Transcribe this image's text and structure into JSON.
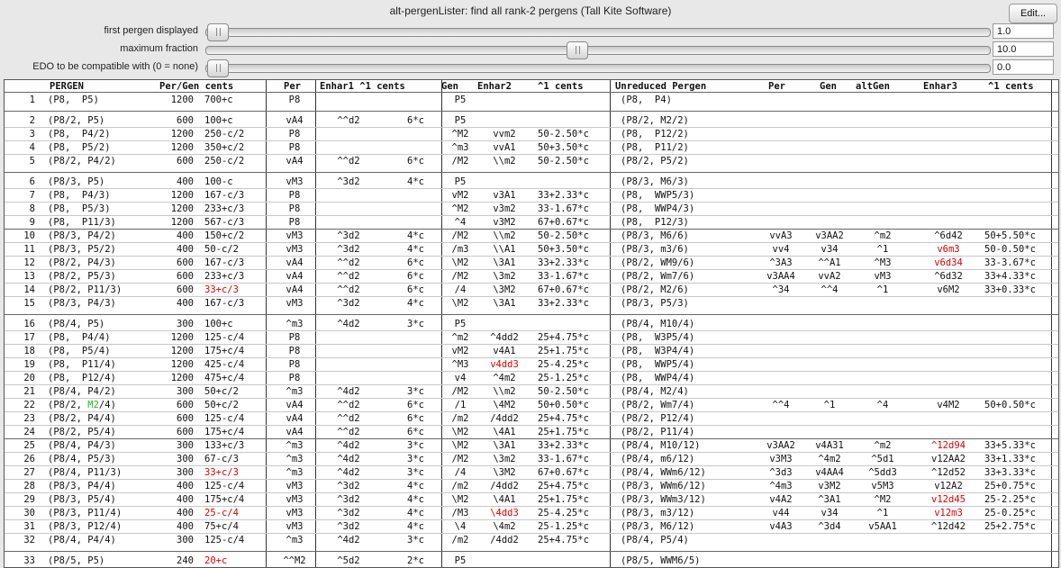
{
  "window": {
    "title": "alt-pergenLister: find all rank-2 pergens (Tall Kite Software)",
    "edit_label": "Edit..."
  },
  "sliders": [
    {
      "label": "first pergen displayed",
      "value": "1.0",
      "fraction": 0.0
    },
    {
      "label": "maximum fraction",
      "value": "10.0",
      "fraction": 0.46
    },
    {
      "label": "EDO to be compatible with (0 = none)",
      "value": "0.0",
      "fraction": 0.0
    }
  ],
  "table": {
    "headers": [
      "PERGEN",
      "Per/Gen cents",
      "Per",
      "Enhar1 ^1 cents",
      "Gen",
      "Enhar2",
      "^1 cents",
      "Unreduced Pergen",
      "Per",
      "Gen",
      "altGen",
      "Enhar3",
      "^1 cents"
    ],
    "rows": [
      {
        "n": "1",
        "pergen": "(P8,  P5)",
        "per_c": "1200",
        "gen_c": "700+c",
        "per": "P8",
        "e1": "",
        "e1c": "",
        "gen": "P5",
        "e2": "",
        "e2c": "",
        "unred": "(P8,  P4)",
        "uper": "",
        "ugen": "",
        "alt": "",
        "e3": "",
        "e3c": ""
      },
      {
        "n": "2",
        "pergen": "(P8/2, P5)",
        "per_c": "600",
        "gen_c": "100+c",
        "per": "vA4",
        "e1": "^^d2",
        "e1c": "6*c",
        "gen": "P5",
        "e2": "",
        "e2c": "",
        "unred": "(P8/2, M2/2)",
        "uper": "",
        "ugen": "",
        "alt": "",
        "e3": "",
        "e3c": ""
      },
      {
        "n": "3",
        "pergen": "(P8,  P4/2)",
        "per_c": "1200",
        "gen_c": "250-c/2",
        "per": "P8",
        "e1": "",
        "e1c": "",
        "gen": "^M2",
        "e2": "vvm2",
        "e2c": "50-2.50*c",
        "unred": "(P8,  P12/2)",
        "uper": "",
        "ugen": "",
        "alt": "",
        "e3": "",
        "e3c": ""
      },
      {
        "n": "4",
        "pergen": "(P8,  P5/2)",
        "per_c": "1200",
        "gen_c": "350+c/2",
        "per": "P8",
        "e1": "",
        "e1c": "",
        "gen": "^m3",
        "e2": "vvA1",
        "e2c": "50+3.50*c",
        "unred": "(P8,  P11/2)",
        "uper": "",
        "ugen": "",
        "alt": "",
        "e3": "",
        "e3c": ""
      },
      {
        "n": "5",
        "pergen": "(P8/2, P4/2)",
        "per_c": "600",
        "gen_c": "250-c/2",
        "per": "vA4",
        "e1": "^^d2",
        "e1c": "6*c",
        "gen": "/M2",
        "e2": "\\\\m2",
        "e2c": "50-2.50*c",
        "unred": "(P8/2, P5/2)",
        "uper": "",
        "ugen": "",
        "alt": "",
        "e3": "",
        "e3c": ""
      },
      {
        "n": "6",
        "pergen": "(P8/3, P5)",
        "per_c": "400",
        "gen_c": "100-c",
        "per": "vM3",
        "e1": "^3d2",
        "e1c": "4*c",
        "gen": "P5",
        "e2": "",
        "e2c": "",
        "unred": "(P8/3, M6/3)",
        "uper": "",
        "ugen": "",
        "alt": "",
        "e3": "",
        "e3c": ""
      },
      {
        "n": "7",
        "pergen": "(P8,  P4/3)",
        "per_c": "1200",
        "gen_c": "167-c/3",
        "per": "P8",
        "e1": "",
        "e1c": "",
        "gen": "vM2",
        "e2": "v3A1",
        "e2c": "33+2.33*c",
        "unred": "(P8,  WWP5/3)",
        "uper": "",
        "ugen": "",
        "alt": "",
        "e3": "",
        "e3c": ""
      },
      {
        "n": "8",
        "pergen": "(P8,  P5/3)",
        "per_c": "1200",
        "gen_c": "233+c/3",
        "per": "P8",
        "e1": "",
        "e1c": "",
        "gen": "^M2",
        "e2": "v3m2",
        "e2c": "33-1.67*c",
        "unred": "(P8,  WWP4/3)",
        "uper": "",
        "ugen": "",
        "alt": "",
        "e3": "",
        "e3c": ""
      },
      {
        "n": "9",
        "pergen": "(P8,  P11/3)",
        "per_c": "1200",
        "gen_c": "567-c/3",
        "per": "P8",
        "e1": "",
        "e1c": "",
        "gen": "^4",
        "e2": "v3M2",
        "e2c": "67+0.67*c",
        "unred": "(P8,  P12/3)",
        "uper": "",
        "ugen": "",
        "alt": "",
        "e3": "",
        "e3c": ""
      },
      {
        "n": "10",
        "pergen": "(P8/3, P4/2)",
        "per_c": "400",
        "gen_c": "150+c/2",
        "per": "vM3",
        "e1": "^3d2",
        "e1c": "4*c",
        "gen": "/M2",
        "e2": "\\\\m2",
        "e2c": "50-2.50*c",
        "unred": "(P8/3, M6/6)",
        "uper": "vvA3",
        "ugen": "v3AA2",
        "alt": "^m2",
        "e3": "^6d42",
        "e3c": "50+5.50*c"
      },
      {
        "n": "11",
        "pergen": "(P8/3, P5/2)",
        "per_c": "400",
        "gen_c": "50-c/2",
        "per": "vM3",
        "e1": "^3d2",
        "e1c": "4*c",
        "gen": "/m3",
        "e2": "\\\\A1",
        "e2c": "50+3.50*c",
        "unred": "(P8/3, m3/6)",
        "uper": "vv4",
        "ugen": "v34",
        "alt": "^1",
        "e3": "v6m3",
        "e3c": "50-0.50*c"
      },
      {
        "n": "12",
        "pergen": "(P8/2, P4/3)",
        "per_c": "600",
        "gen_c": "167-c/3",
        "per": "vA4",
        "e1": "^^d2",
        "e1c": "6*c",
        "gen": "\\M2",
        "e2": "\\3A1",
        "e2c": "33+2.33*c",
        "unred": "(P8/2, WM9/6)",
        "uper": "^3A3",
        "ugen": "^^A1",
        "alt": "^M3",
        "e3": "v6d34",
        "e3c": "33-3.67*c"
      },
      {
        "n": "13",
        "pergen": "(P8/2, P5/3)",
        "per_c": "600",
        "gen_c": "233+c/3",
        "per": "vA4",
        "e1": "^^d2",
        "e1c": "6*c",
        "gen": "/M2",
        "e2": "\\3m2",
        "e2c": "33-1.67*c",
        "unred": "(P8/2, Wm7/6)",
        "uper": "v3AA4",
        "ugen": "vvA2",
        "alt": "vM3",
        "e3": "^6d32",
        "e3c": "33+4.33*c"
      },
      {
        "n": "14",
        "pergen": "(P8/2, P11/3)",
        "per_c": "600",
        "gen_c": "33+c/3",
        "per": "vA4",
        "e1": "^^d2",
        "e1c": "6*c",
        "gen": "/4",
        "e2": "\\3M2",
        "e2c": "67+0.67*c",
        "unred": "(P8/2, M2/6)",
        "uper": "^34",
        "ugen": "^^4",
        "alt": "^1",
        "e3": "v6M2",
        "e3c": "33+0.33*c"
      },
      {
        "n": "15",
        "pergen": "(P8/3, P4/3)",
        "per_c": "400",
        "gen_c": "167-c/3",
        "per": "vM3",
        "e1": "^3d2",
        "e1c": "4*c",
        "gen": "\\M2",
        "e2": "\\3A1",
        "e2c": "33+2.33*c",
        "unred": "(P8/3, P5/3)",
        "uper": "",
        "ugen": "",
        "alt": "",
        "e3": "",
        "e3c": ""
      },
      {
        "n": "16",
        "pergen": "(P8/4, P5)",
        "per_c": "300",
        "gen_c": "100+c",
        "per": "^m3",
        "e1": "^4d2",
        "e1c": "3*c",
        "gen": "P5",
        "e2": "",
        "e2c": "",
        "unred": "(P8/4, M10/4)",
        "uper": "",
        "ugen": "",
        "alt": "",
        "e3": "",
        "e3c": ""
      },
      {
        "n": "17",
        "pergen": "(P8,  P4/4)",
        "per_c": "1200",
        "gen_c": "125-c/4",
        "per": "P8",
        "e1": "",
        "e1c": "",
        "gen": "^m2",
        "e2": "^4dd2",
        "e2c": "25+4.75*c",
        "unred": "(P8,  W3P5/4)",
        "uper": "",
        "ugen": "",
        "alt": "",
        "e3": "",
        "e3c": ""
      },
      {
        "n": "18",
        "pergen": "(P8,  P5/4)",
        "per_c": "1200",
        "gen_c": "175+c/4",
        "per": "P8",
        "e1": "",
        "e1c": "",
        "gen": "vM2",
        "e2": "v4A1",
        "e2c": "25+1.75*c",
        "unred": "(P8,  W3P4/4)",
        "uper": "",
        "ugen": "",
        "alt": "",
        "e3": "",
        "e3c": ""
      },
      {
        "n": "19",
        "pergen": "(P8,  P11/4)",
        "per_c": "1200",
        "gen_c": "425-c/4",
        "per": "P8",
        "e1": "",
        "e1c": "",
        "gen": "^M3",
        "e2": "v4dd3",
        "e2c": "25-4.25*c",
        "unred": "(P8,  WWP5/4)",
        "uper": "",
        "ugen": "",
        "alt": "",
        "e3": "",
        "e3c": ""
      },
      {
        "n": "20",
        "pergen": "(P8,  P12/4)",
        "per_c": "1200",
        "gen_c": "475+c/4",
        "per": "P8",
        "e1": "",
        "e1c": "",
        "gen": "v4",
        "e2": "^4m2",
        "e2c": "25-1.25*c",
        "unred": "(P8,  WWP4/4)",
        "uper": "",
        "ugen": "",
        "alt": "",
        "e3": "",
        "e3c": ""
      },
      {
        "n": "21",
        "pergen": "(P8/4, P4/2)",
        "per_c": "300",
        "gen_c": "50+c/2",
        "per": "^m3",
        "e1": "^4d2",
        "e1c": "3*c",
        "gen": "/M2",
        "e2": "\\\\m2",
        "e2c": "50-2.50*c",
        "unred": "(P8/4, M2/4)",
        "uper": "",
        "ugen": "",
        "alt": "",
        "e3": "",
        "e3c": ""
      },
      {
        "n": "22",
        "pergen": "(P8/2, M2/4)",
        "per_c": "600",
        "gen_c": "50+c/2",
        "per": "vA4",
        "e1": "^^d2",
        "e1c": "6*c",
        "gen": "/1",
        "e2": "\\4M2",
        "e2c": "50+0.50*c",
        "unred": "(P8/2, Wm7/4)",
        "uper": "^^4",
        "ugen": "^1",
        "alt": "^4",
        "e3": "v4M2",
        "e3c": "50+0.50*c"
      },
      {
        "n": "23",
        "pergen": "(P8/2, P4/4)",
        "per_c": "600",
        "gen_c": "125-c/4",
        "per": "vA4",
        "e1": "^^d2",
        "e1c": "6*c",
        "gen": "/m2",
        "e2": "/4dd2",
        "e2c": "25+4.75*c",
        "unred": "(P8/2, P12/4)",
        "uper": "",
        "ugen": "",
        "alt": "",
        "e3": "",
        "e3c": ""
      },
      {
        "n": "24",
        "pergen": "(P8/2, P5/4)",
        "per_c": "600",
        "gen_c": "175+c/4",
        "per": "vA4",
        "e1": "^^d2",
        "e1c": "6*c",
        "gen": "\\M2",
        "e2": "\\4A1",
        "e2c": "25+1.75*c",
        "unred": "(P8/2, P11/4)",
        "uper": "",
        "ugen": "",
        "alt": "",
        "e3": "",
        "e3c": ""
      },
      {
        "n": "25",
        "pergen": "(P8/4, P4/3)",
        "per_c": "300",
        "gen_c": "133+c/3",
        "per": "^m3",
        "e1": "^4d2",
        "e1c": "3*c",
        "gen": "\\M2",
        "e2": "\\3A1",
        "e2c": "33+2.33*c",
        "unred": "(P8/4, M10/12)",
        "uper": "v3AA2",
        "ugen": "v4A31",
        "alt": "^m2",
        "e3": "^12d94",
        "e3c": "33+5.33*c"
      },
      {
        "n": "26",
        "pergen": "(P8/4, P5/3)",
        "per_c": "300",
        "gen_c": "67-c/3",
        "per": "^m3",
        "e1": "^4d2",
        "e1c": "3*c",
        "gen": "/M2",
        "e2": "\\3m2",
        "e2c": "33-1.67*c",
        "unred": "(P8/4, m6/12)",
        "uper": "v3M3",
        "ugen": "^4m2",
        "alt": "^5d1",
        "e3": "v12AA2",
        "e3c": "33+1.33*c"
      },
      {
        "n": "27",
        "pergen": "(P8/4, P11/3)",
        "per_c": "300",
        "gen_c": "33+c/3",
        "per": "^m3",
        "e1": "^4d2",
        "e1c": "3*c",
        "gen": "/4",
        "e2": "\\3M2",
        "e2c": "67+0.67*c",
        "unred": "(P8/4, WWm6/12)",
        "uper": "^3d3",
        "ugen": "v4AA4",
        "alt": "^5dd3",
        "e3": "^12d52",
        "e3c": "33+3.33*c"
      },
      {
        "n": "28",
        "pergen": "(P8/3, P4/4)",
        "per_c": "400",
        "gen_c": "125-c/4",
        "per": "vM3",
        "e1": "^3d2",
        "e1c": "4*c",
        "gen": "/m2",
        "e2": "/4dd2",
        "e2c": "25+4.75*c",
        "unred": "(P8/3, WWm6/12)",
        "uper": "^4m3",
        "ugen": "v3M2",
        "alt": "v5M3",
        "e3": "v12A2",
        "e3c": "25+0.75*c"
      },
      {
        "n": "29",
        "pergen": "(P8/3, P5/4)",
        "per_c": "400",
        "gen_c": "175+c/4",
        "per": "vM3",
        "e1": "^3d2",
        "e1c": "4*c",
        "gen": "\\M2",
        "e2": "\\4A1",
        "e2c": "25+1.75*c",
        "unred": "(P8/3, WWm3/12)",
        "uper": "v4A2",
        "ugen": "^3A1",
        "alt": "^M2",
        "e3": "v12d45",
        "e3c": "25-2.25*c"
      },
      {
        "n": "30",
        "pergen": "(P8/3, P11/4)",
        "per_c": "400",
        "gen_c": "25-c/4",
        "per": "vM3",
        "e1": "^3d2",
        "e1c": "4*c",
        "gen": "/M3",
        "e2": "\\4dd3",
        "e2c": "25-4.25*c",
        "unred": "(P8/3, m3/12)",
        "uper": "v44",
        "ugen": "v34",
        "alt": "^1",
        "e3": "v12m3",
        "e3c": "25-0.25*c"
      },
      {
        "n": "31",
        "pergen": "(P8/3, P12/4)",
        "per_c": "400",
        "gen_c": "75+c/4",
        "per": "vM3",
        "e1": "^3d2",
        "e1c": "4*c",
        "gen": "\\4",
        "e2": "\\4m2",
        "e2c": "25-1.25*c",
        "unred": "(P8/3, M6/12)",
        "uper": "v4A3",
        "ugen": "^3d4",
        "alt": "v5AA1",
        "e3": "^12d42",
        "e3c": "25+2.75*c"
      },
      {
        "n": "32",
        "pergen": "(P8/4, P4/4)",
        "per_c": "300",
        "gen_c": "125-c/4",
        "per": "^m3",
        "e1": "^4d2",
        "e1c": "3*c",
        "gen": "/m2",
        "e2": "/4dd2",
        "e2c": "25+4.75*c",
        "unred": "(P8/4, P5/4)",
        "uper": "",
        "ugen": "",
        "alt": "",
        "e3": "",
        "e3c": ""
      },
      {
        "n": "33",
        "pergen": "(P8/5, P5)",
        "per_c": "240",
        "gen_c": "20+c",
        "per": "^^M2",
        "e1": "^5d2",
        "e1c": "2*c",
        "gen": "P5",
        "e2": "",
        "e2c": "",
        "unred": "(P8/5, WWM6/5)",
        "uper": "",
        "ugen": "",
        "alt": "",
        "e3": "",
        "e3c": ""
      }
    ],
    "highlights": [
      {
        "row": 14,
        "field": "gen_c",
        "color": "#e00000"
      },
      {
        "row": 19,
        "field": "e2",
        "color": "#e00000"
      },
      {
        "row": 11,
        "field": "e3",
        "color": "#e00000"
      },
      {
        "row": 12,
        "field": "e3",
        "color": "#e00000"
      },
      {
        "row": 22,
        "field": "pergen_part",
        "color": "#22bb22"
      },
      {
        "row": 25,
        "field": "e3",
        "color": "#e00000"
      },
      {
        "row": 27,
        "field": "gen_c",
        "color": "#e00000"
      },
      {
        "row": 29,
        "field": "e3",
        "color": "#e00000"
      },
      {
        "row": 30,
        "field": "gen_c",
        "color": "#e00000"
      },
      {
        "row": 30,
        "field": "e2",
        "color": "#e00000"
      },
      {
        "row": 30,
        "field": "e3",
        "color": "#e00000"
      },
      {
        "row": 33,
        "field": "gen_c",
        "color": "#e00000"
      }
    ]
  }
}
